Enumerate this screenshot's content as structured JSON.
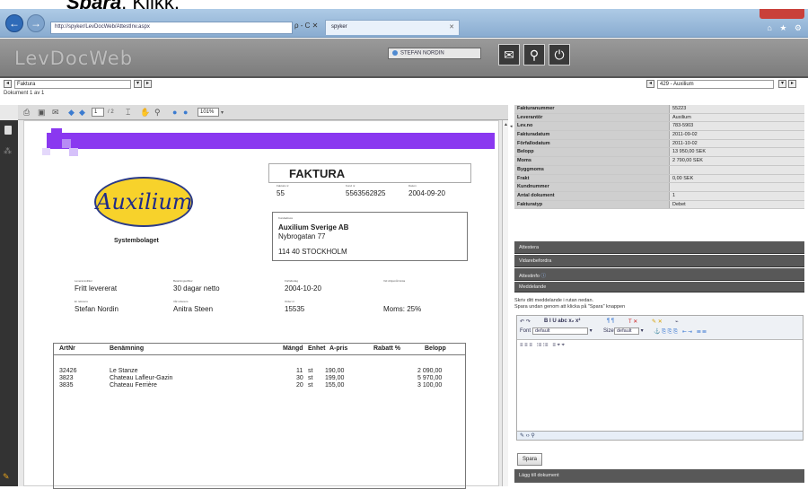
{
  "caption": {
    "prefix": "",
    "bold": "Spara",
    "suffix": ". Klikk."
  },
  "browser": {
    "url": "http://spyker/LevDocWeb/AttestInv.aspx",
    "addr_tools": "ρ - C ✕",
    "tab_title": "spyker"
  },
  "app": {
    "logo": "LevDocWeb",
    "user": "STEFAN NORDIN"
  },
  "selectors": {
    "doc_type": "Faktura",
    "doc_count": "Dokument 1 av 1",
    "supplier": "429 - Auxilium"
  },
  "viewer": {
    "page_current": "1",
    "page_total": "/ 2",
    "zoom": "101%"
  },
  "invoice": {
    "title": "FAKTURA",
    "logo_text": "Auxilium",
    "company": "Systembolaget",
    "lbl_fakturanr": "Faktura nr",
    "lbl_kundnr": "Kund nr",
    "lbl_datum": "Datum",
    "fakturanr": "55",
    "kundnr": "5563562825",
    "datum": "2004-09-20",
    "lbl_kundadress": "Kundadress",
    "addr_name": "Auxilium Sverige AB",
    "addr_street": "Nybrogatan 77",
    "addr_city": "114 40 STOCKHOLM",
    "lbl_leveransvillkor": "Leveransvillkor",
    "lbl_betalningsvillkor": "Betalningsvillkor",
    "lbl_forfallodag": "Förfallodag",
    "lbl_drojsmal": "Vid dröjsmål ränta",
    "leveransvillkor": "Fritt levererat",
    "betalningsvillkor": "30 dagar netto",
    "forfallodag": "2004-10-20",
    "lbl_er_referens": "Er referens",
    "lbl_var_referens": "Vår referens",
    "lbl_order_nr": "Order nr",
    "er_referens": "Stefan Nordin",
    "var_referens": "Anitra Steen",
    "order_nr": "15535",
    "moms": "Moms: 25%",
    "columns": [
      "ArtNr",
      "Benämning",
      "Mängd",
      "Enhet",
      "A-pris",
      "Rabatt %",
      "Belopp"
    ],
    "rows": [
      {
        "artnr": "32426",
        "benamning": "Le Stanze",
        "mangd": "11",
        "enhet": "st",
        "apris": "190,00",
        "belopp": "2 090,00"
      },
      {
        "artnr": "3823",
        "benamning": "Chateau Lafleur-Gazin",
        "mangd": "30",
        "enhet": "st",
        "apris": "199,00",
        "belopp": "5 970,00"
      },
      {
        "artnr": "3835",
        "benamning": "Chateau Ferrière",
        "mangd": "20",
        "enhet": "st",
        "apris": "155,00",
        "belopp": "3 100,00"
      }
    ]
  },
  "props": [
    {
      "k": "Fakturanummer",
      "v": "55223"
    },
    {
      "k": "Leverantör",
      "v": "Auxilium"
    },
    {
      "k": "Lev.no",
      "v": "783-5903"
    },
    {
      "k": "Fakturadatum",
      "v": "2011-09-02"
    },
    {
      "k": "Förfallodatum",
      "v": "2011-10-02"
    },
    {
      "k": "Belopp",
      "v": "13 950,00 SEK"
    },
    {
      "k": "Moms",
      "v": "2 790,00 SEK"
    },
    {
      "k": "Byggmoms",
      "v": ""
    },
    {
      "k": "Frakt",
      "v": "0,00 SEK"
    },
    {
      "k": "Kundnummer",
      "v": ""
    },
    {
      "k": "Antal dokument",
      "v": "1"
    },
    {
      "k": "Fakturatyp",
      "v": "Debet"
    }
  ],
  "panels": {
    "attestera": "Attestera",
    "vidarebefordra": "Vidarebefordra",
    "attestinfo": "Attestinfo",
    "meddelande": "Meddelande",
    "msg_line1": "Skriv ditt meddelande i rutan nedan.",
    "msg_line2": "Spara undan genom att klicka på \"Spara\" knappen",
    "font_label": "Font",
    "font_value": "default",
    "size_label": "Size",
    "size_value": "default",
    "spara": "Spara",
    "lagg_till": "Lägg till dokument"
  }
}
